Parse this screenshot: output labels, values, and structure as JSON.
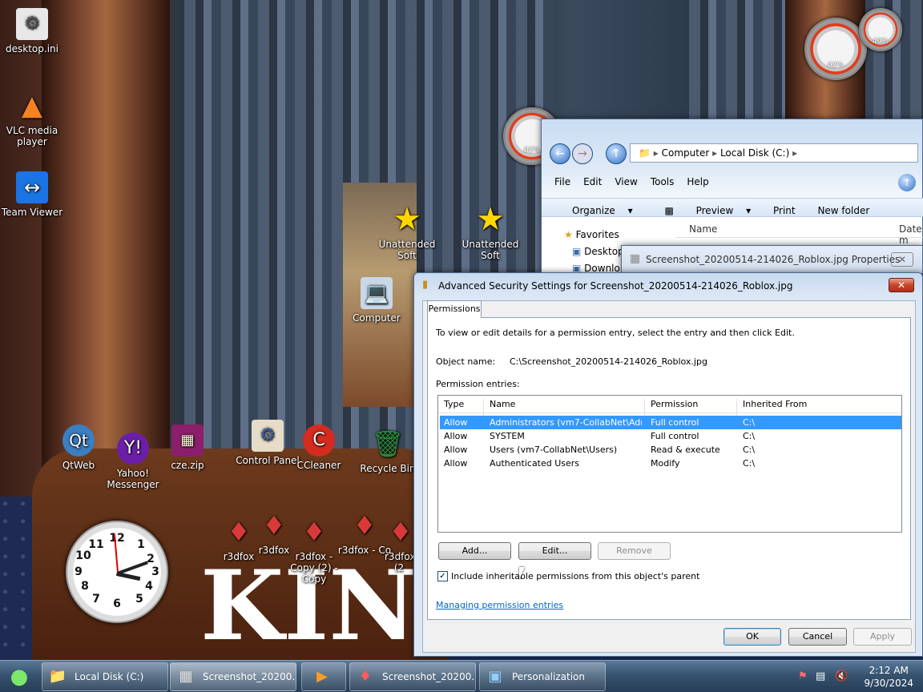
{
  "desktop": {
    "icons": [
      {
        "label": "desktop.ini",
        "icon": "ini-file-icon"
      },
      {
        "label": "VLC media player",
        "icon": "vlc-icon"
      },
      {
        "label": "Team Viewer",
        "icon": "teamviewer-icon"
      },
      {
        "label": "Unattended Soft",
        "icon": "star-icon"
      },
      {
        "label": "Unattended Soft",
        "icon": "star-icon"
      },
      {
        "label": "Computer",
        "icon": "computer-icon"
      },
      {
        "label": "QtWeb",
        "icon": "qtweb-icon"
      },
      {
        "label": "Yahoo! Messenger",
        "icon": "yahoo-icon"
      },
      {
        "label": "cze.zip",
        "icon": "winrar-icon"
      },
      {
        "label": "Control Panel",
        "icon": "control-panel-icon"
      },
      {
        "label": "CCleaner",
        "icon": "ccleaner-icon"
      },
      {
        "label": "Recycle Bin",
        "icon": "recycle-bin-icon"
      },
      {
        "label": "r3dfox",
        "icon": "r3dfox-icon"
      },
      {
        "label": "r3dfox",
        "icon": "r3dfox-icon"
      },
      {
        "label": "r3dfox - Copy (2) - Copy",
        "icon": "r3dfox-icon"
      },
      {
        "label": "r3dfox - Co",
        "icon": "r3dfox-icon"
      },
      {
        "label": "r3dfox (2",
        "icon": "r3dfox-icon"
      }
    ],
    "background_text": "KING",
    "gadget": {
      "cpu": "02%",
      "mem": "40%",
      "cpu2": "02%"
    }
  },
  "explorer": {
    "address": [
      "Computer",
      "Local Disk (C:)"
    ],
    "menu": [
      "File",
      "Edit",
      "View",
      "Tools",
      "Help"
    ],
    "commands": [
      "Organize",
      "Preview",
      "Print",
      "New folder"
    ],
    "nav": [
      "Favorites",
      "Desktop",
      "Downlo"
    ],
    "columns": [
      "Name",
      "Date m"
    ]
  },
  "properties": {
    "title": "Screenshot_20200514-214026_Roblox.jpg Properties",
    "close": "✕"
  },
  "dialog": {
    "title": "Advanced Security Settings for Screenshot_20200514-214026_Roblox.jpg",
    "close": "✕",
    "tab": "Permissions",
    "intro": "To view or edit details for a permission entry, select the entry and then click Edit.",
    "object_label": "Object name:",
    "object_value": "C:\\Screenshot_20200514-214026_Roblox.jpg",
    "entries_label": "Permission entries:",
    "columns": [
      "Type",
      "Name",
      "Permission",
      "Inherited From"
    ],
    "rows": [
      {
        "type": "Allow",
        "name": "Administrators (vm7-CollabNet\\Admi...",
        "permission": "Full control",
        "inherited": "C:\\"
      },
      {
        "type": "Allow",
        "name": "SYSTEM",
        "permission": "Full control",
        "inherited": "C:\\"
      },
      {
        "type": "Allow",
        "name": "Users (vm7-CollabNet\\Users)",
        "permission": "Read & execute",
        "inherited": "C:\\"
      },
      {
        "type": "Allow",
        "name": "Authenticated Users",
        "permission": "Modify",
        "inherited": "C:\\"
      }
    ],
    "add": "Add...",
    "edit": "Edit...",
    "remove": "Remove",
    "inherit_label": "Include inheritable permissions from this object's parent",
    "inherit_checked": "✓",
    "manage_link": "Managing permission entries",
    "ok": "OK",
    "cancel": "Cancel",
    "apply": "Apply"
  },
  "taskbar": {
    "items": [
      {
        "label": "Local Disk (C:)",
        "icon": "folder-icon"
      },
      {
        "label": "Screenshot_20200...",
        "icon": "image-file-icon"
      },
      {
        "label": "",
        "icon": "media-player-icon"
      },
      {
        "label": "Screenshot_20200...",
        "icon": "r3dfox-icon"
      },
      {
        "label": "Personalization",
        "icon": "personalization-icon"
      }
    ],
    "time": "2:12 AM",
    "date": "9/30/2024"
  }
}
